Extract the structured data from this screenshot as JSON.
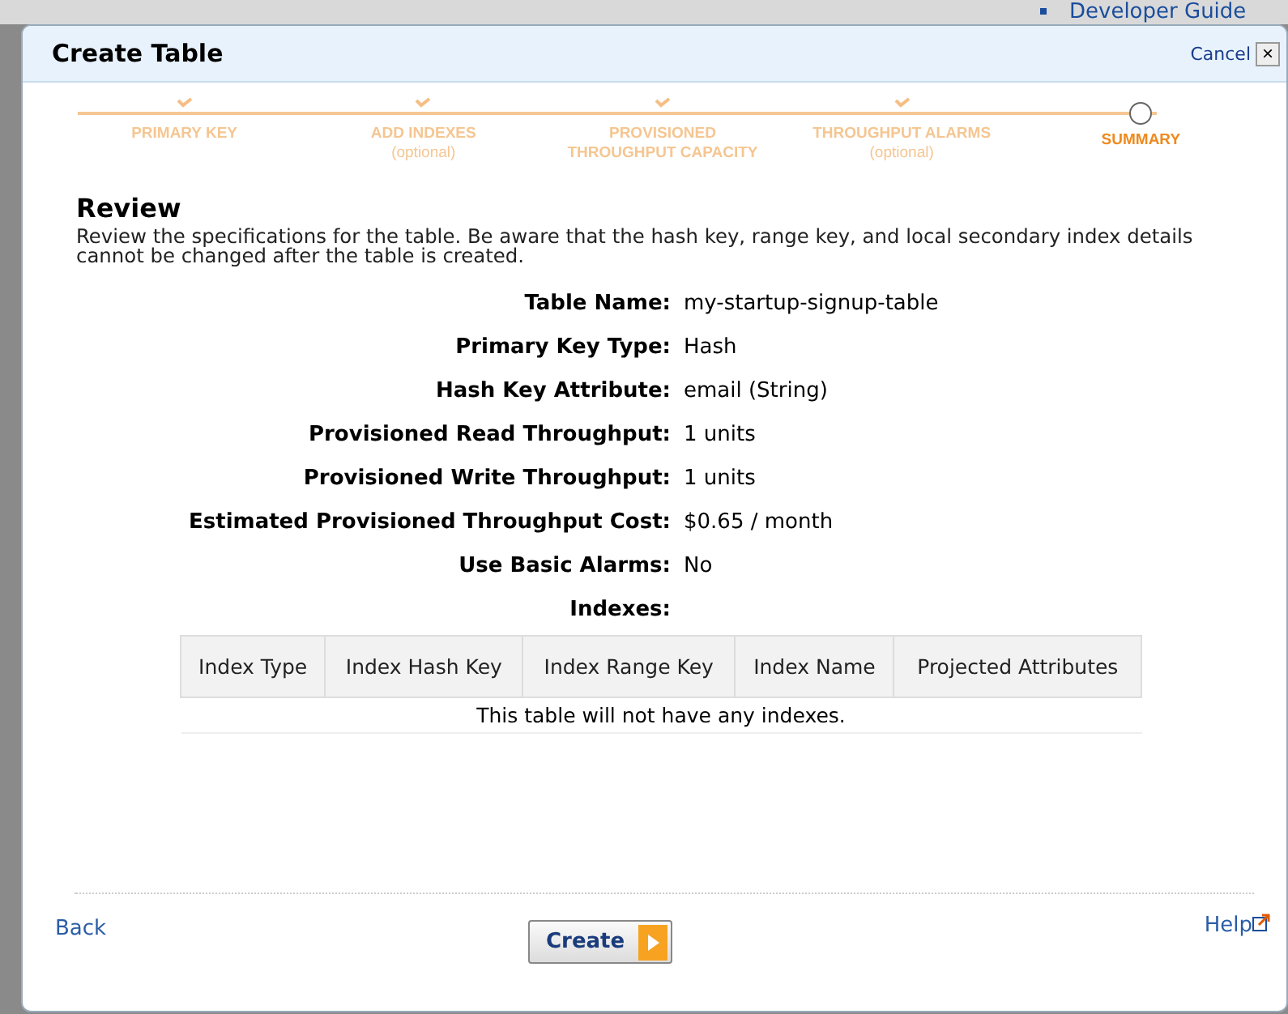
{
  "background": {
    "link": "Developer Guide"
  },
  "dialog": {
    "title": "Create Table",
    "cancel": "Cancel",
    "close": "×"
  },
  "steps": [
    {
      "label": "PRIMARY KEY",
      "selected": false
    },
    {
      "label": "ADD INDEXES",
      "note": "(optional)",
      "selected": false
    },
    {
      "label": "PROVISIONED THROUGHPUT CAPACITY",
      "selected": false
    },
    {
      "label": "THROUGHPUT ALARMS",
      "note": "(optional)",
      "selected": false
    },
    {
      "label": "SUMMARY",
      "selected": true
    }
  ],
  "review": {
    "heading": "Review",
    "description": "Review the specifications for the table. Be aware that the hash key, range key, and local secondary index details cannot be changed after the table is created.",
    "fields": [
      {
        "label": "Table Name:",
        "value": "my-startup-signup-table"
      },
      {
        "label": "Primary Key Type:",
        "value": "Hash"
      },
      {
        "label": "Hash Key Attribute:",
        "value": "email (String)"
      },
      {
        "label": "Provisioned Read Throughput:",
        "value": "1 units"
      },
      {
        "label": "Provisioned Write Throughput:",
        "value": "1 units"
      },
      {
        "label": "Estimated Provisioned Throughput Cost:",
        "value": "$0.65 / month"
      },
      {
        "label": "Use Basic Alarms:",
        "value": "No"
      },
      {
        "label": "Indexes:"
      }
    ]
  },
  "table": {
    "columns": [
      "Index Type",
      "Index Hash Key",
      "Index Range Key",
      "Index Name",
      "Projected Attributes"
    ],
    "empty_message": "This table will not have any indexes."
  },
  "footer": {
    "back": "Back",
    "create": "Create",
    "help": "Help"
  }
}
